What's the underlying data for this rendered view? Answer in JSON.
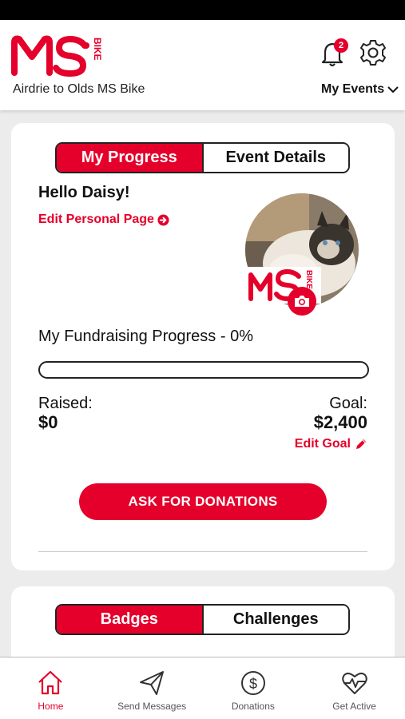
{
  "header": {
    "event_name": "Airdrie to Olds MS Bike",
    "notification_count": "2",
    "my_events_label": "My Events",
    "logo_text": "MS BIKE"
  },
  "progress_card": {
    "tabs": [
      {
        "label": "My Progress",
        "active": true
      },
      {
        "label": "Event Details",
        "active": false
      }
    ],
    "greeting": "Hello Daisy!",
    "edit_personal_page": "Edit Personal Page",
    "fundraising_label": "My Fundraising Progress - 0%",
    "progress_fraction": 0,
    "raised_label": "Raised:",
    "raised_value": "$0",
    "goal_label": "Goal:",
    "goal_value": "$2,400",
    "edit_goal": "Edit Goal",
    "ask_button": "ASK FOR DONATIONS"
  },
  "badges_card": {
    "tabs": [
      {
        "label": "Badges",
        "active": true
      },
      {
        "label": "Challenges",
        "active": false
      }
    ]
  },
  "tabbar": {
    "items": [
      {
        "label": "Home",
        "icon": "home-icon",
        "active": true
      },
      {
        "label": "Send Messages",
        "icon": "paper-plane-icon",
        "active": false
      },
      {
        "label": "Donations",
        "icon": "dollar-circle-icon",
        "active": false
      },
      {
        "label": "Get Active",
        "icon": "heart-pulse-icon",
        "active": false
      }
    ]
  },
  "colors": {
    "accent": "#e4002b",
    "background": "#ececec"
  }
}
